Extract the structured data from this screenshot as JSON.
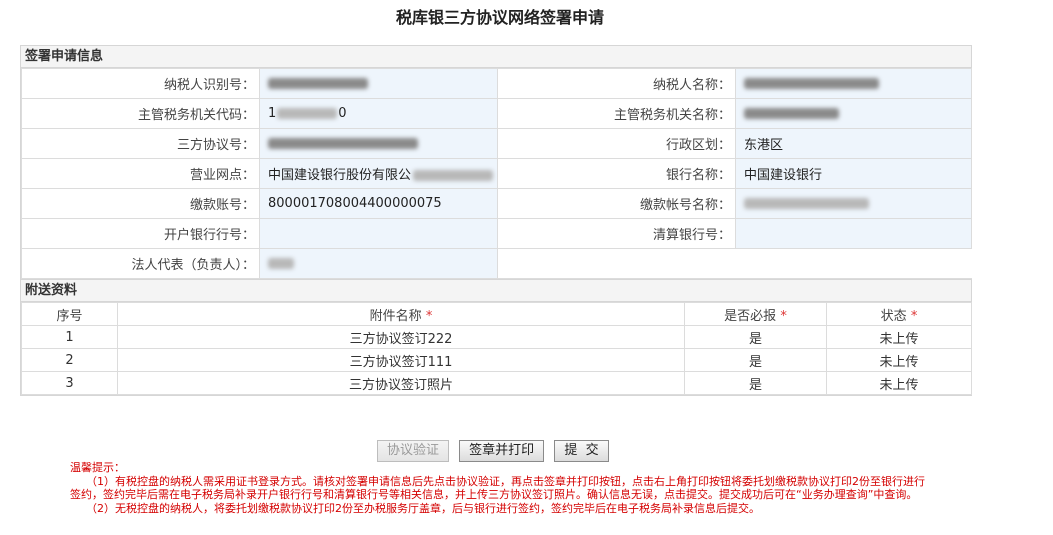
{
  "page": {
    "title": "税库银三方协议网络签署申请"
  },
  "sign_info": {
    "section_title": "签署申请信息",
    "rows": [
      {
        "left_label": "纳税人识别号：",
        "left_value": "",
        "right_label": "纳税人名称：",
        "right_value": ""
      },
      {
        "left_label": "主管税务机关代码：",
        "left_value": "1",
        "left_value_suffix": "0",
        "right_label": "主管税务机关名称：",
        "right_value": ""
      },
      {
        "left_label": "三方协议号：",
        "left_value": "",
        "right_label": "行政区划：",
        "right_value": "东港区"
      },
      {
        "left_label": "营业网点：",
        "left_value": "中国建设银行股份有限公",
        "right_label": "银行名称：",
        "right_value": "中国建设银行"
      },
      {
        "left_label": "缴款账号：",
        "left_value": "800001708004400000075",
        "right_label": "缴款帐号名称：",
        "right_value": ""
      },
      {
        "left_label": "开户银行行号：",
        "left_value": "",
        "right_label": "清算银行号：",
        "right_value": ""
      },
      {
        "left_label": "法人代表（负责人）：",
        "left_value": ""
      }
    ]
  },
  "attachments": {
    "section_title": "附送资料",
    "headers": {
      "seq": "序号",
      "name": "附件名称",
      "required": "是否必报",
      "status": "状态",
      "star": "*"
    },
    "rows": [
      {
        "seq": "1",
        "name": "三方协议签订222",
        "required": "是",
        "status": "未上传"
      },
      {
        "seq": "2",
        "name": "三方协议签订111",
        "required": "是",
        "status": "未上传"
      },
      {
        "seq": "3",
        "name": "三方协议签订照片",
        "required": "是",
        "status": "未上传"
      }
    ]
  },
  "buttons": {
    "verify": "协议验证",
    "sign_print": "签章并打印",
    "submit": "提  交"
  },
  "tips": {
    "title": "温馨提示：",
    "line1": "（1）有税控盘的纳税人需采用证书登录方式。请核对签署申请信息后先点击协议验证，再点击签章并打印按钮，点击右上角打印按钮将委托划缴税款协议打印2份至银行进行签约，签约完毕后需在电子税务局补录开户银行行号和清算银行号等相关信息，并上传三方协议签订照片。确认信息无误，点击提交。提交成功后可在“业务办理查询”中查询。",
    "line2": "（2）无税控盘的纳税人，将委托划缴税款协议打印2份至办税服务厅盖章，后与银行进行签约，签约完毕后在电子税务局补录信息后提交。"
  },
  "colors": {
    "accent_status": "#e8632a",
    "tips_red": "#d40000",
    "value_bg": "#eef5fc"
  }
}
